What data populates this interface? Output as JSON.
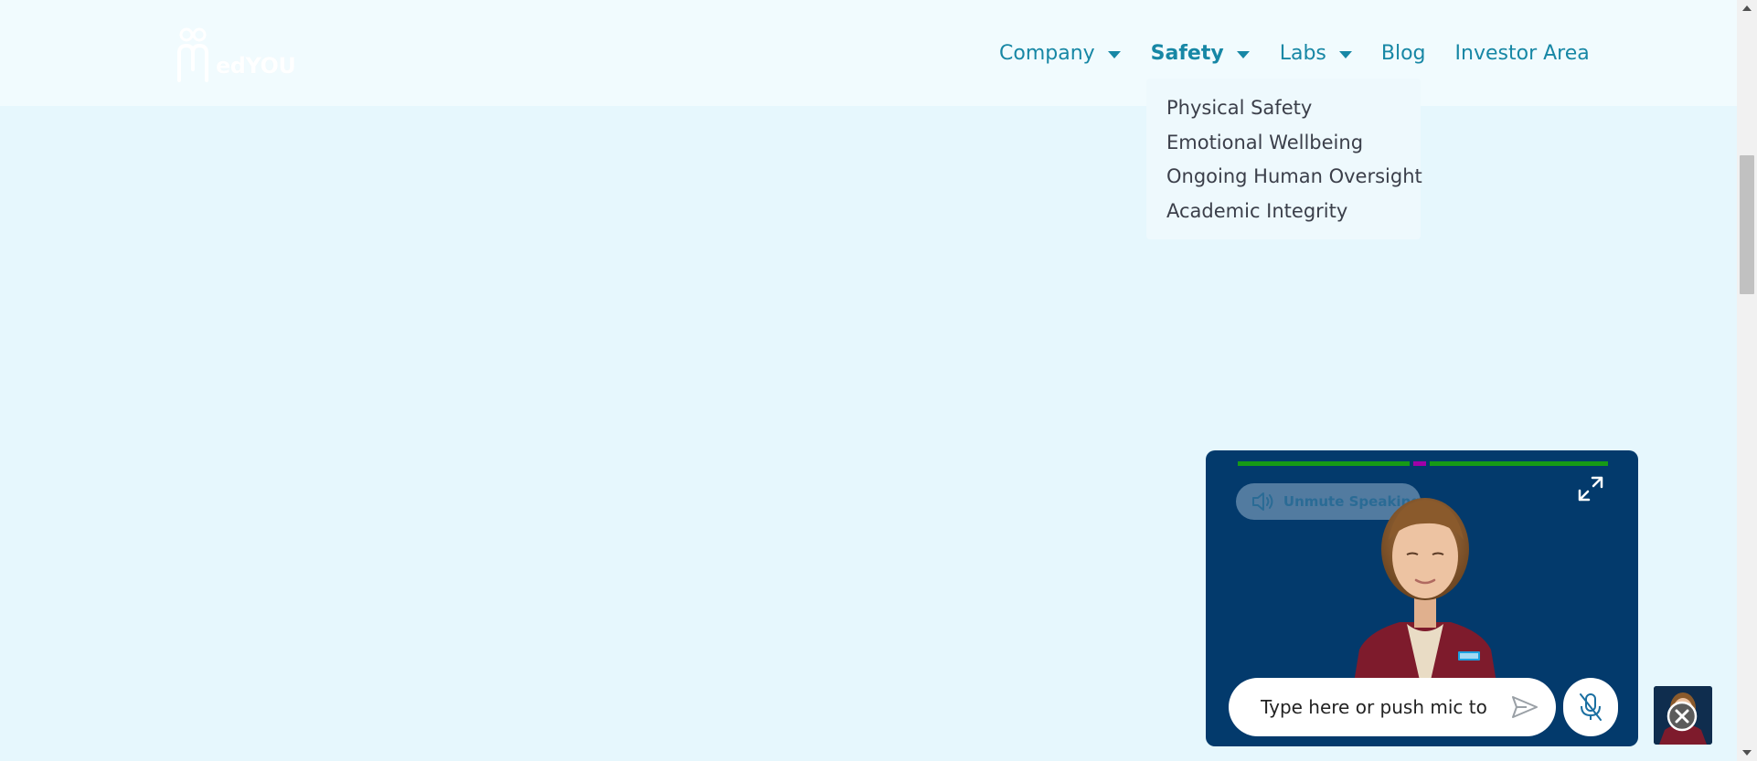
{
  "brand": {
    "logo_text": "edYOU"
  },
  "nav": {
    "items": [
      {
        "label": "Company",
        "has_dropdown": true
      },
      {
        "label": "Safety",
        "has_dropdown": true,
        "active": true
      },
      {
        "label": "Labs",
        "has_dropdown": true
      },
      {
        "label": "Blog",
        "has_dropdown": false
      },
      {
        "label": "Investor Area",
        "has_dropdown": false
      }
    ]
  },
  "safety_dropdown": {
    "items": [
      "Physical Safety",
      "Emotional Wellbeing",
      "Ongoing Human Oversight",
      "Academic Integrity"
    ]
  },
  "avatar_widget": {
    "unmute_label": "Unmute Speaking",
    "input_placeholder": "Type here or push mic to",
    "expand_icon": "expand-icon",
    "speaker_icon": "speaker-icon",
    "send_icon": "send-icon",
    "mic_icon": "mic-off-icon",
    "close_icon": "close-icon"
  },
  "colors": {
    "page_bg": "#e6f7fd",
    "header_bg": "#f1fbfe",
    "nav_text": "#1787a5",
    "dropdown_text": "#3b3f4a",
    "widget_bg": "#033a6c",
    "meter_green": "#169a16",
    "meter_magenta": "#a100a8"
  }
}
